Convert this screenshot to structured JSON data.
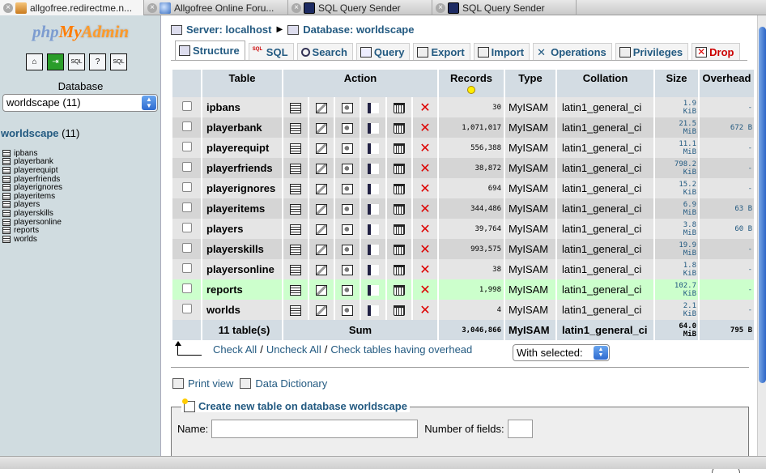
{
  "browser_tabs": [
    {
      "title": "allgofree.redirectme.n...",
      "active": true,
      "icon": "pma-favicon"
    },
    {
      "title": "Allgofree Online Foru...",
      "active": false,
      "icon": "globe-favicon"
    },
    {
      "title": "SQL Query Sender",
      "active": false,
      "icon": "sql-favicon"
    },
    {
      "title": "SQL Query Sender",
      "active": false,
      "icon": "sql-favicon"
    }
  ],
  "sidebar": {
    "logo_php": "php",
    "logo_my": "My",
    "logo_admin": "Admin",
    "db_label": "Database",
    "db_select": "worldscape (11)",
    "db_name": "worldscape",
    "db_count": " (11)",
    "tables": [
      "ipbans",
      "playerbank",
      "playerequipt",
      "playerfriends",
      "playerignores",
      "playeritems",
      "players",
      "playerskills",
      "playersonline",
      "reports",
      "worlds"
    ]
  },
  "breadcrumb": {
    "server": "Server: localhost",
    "database": "Database: worldscape"
  },
  "tabs": [
    "Structure",
    "SQL",
    "Search",
    "Query",
    "Export",
    "Import",
    "Operations",
    "Privileges",
    "Drop"
  ],
  "table": {
    "headers": {
      "table": "Table",
      "action": "Action",
      "records": "Records",
      "type": "Type",
      "collation": "Collation",
      "size": "Size",
      "overhead": "Overhead"
    },
    "rows": [
      {
        "name": "ipbans",
        "records": "30",
        "type": "MyISAM",
        "collation": "latin1_general_ci",
        "size1": "1.9",
        "size2": "KiB",
        "overhead": "-"
      },
      {
        "name": "playerbank",
        "records": "1,071,017",
        "type": "MyISAM",
        "collation": "latin1_general_ci",
        "size1": "21.5",
        "size2": "MiB",
        "overhead": "672 B"
      },
      {
        "name": "playerequipt",
        "records": "556,388",
        "type": "MyISAM",
        "collation": "latin1_general_ci",
        "size1": "11.1",
        "size2": "MiB",
        "overhead": "-"
      },
      {
        "name": "playerfriends",
        "records": "38,872",
        "type": "MyISAM",
        "collation": "latin1_general_ci",
        "size1": "798.2",
        "size2": "KiB",
        "overhead": "-"
      },
      {
        "name": "playerignores",
        "records": "694",
        "type": "MyISAM",
        "collation": "latin1_general_ci",
        "size1": "15.2",
        "size2": "KiB",
        "overhead": "-"
      },
      {
        "name": "playeritems",
        "records": "344,486",
        "type": "MyISAM",
        "collation": "latin1_general_ci",
        "size1": "6.9",
        "size2": "MiB",
        "overhead": "63 B"
      },
      {
        "name": "players",
        "records": "39,764",
        "type": "MyISAM",
        "collation": "latin1_general_ci",
        "size1": "3.8",
        "size2": "MiB",
        "overhead": "60 B"
      },
      {
        "name": "playerskills",
        "records": "993,575",
        "type": "MyISAM",
        "collation": "latin1_general_ci",
        "size1": "19.9",
        "size2": "MiB",
        "overhead": "-"
      },
      {
        "name": "playersonline",
        "records": "38",
        "type": "MyISAM",
        "collation": "latin1_general_ci",
        "size1": "1.8",
        "size2": "KiB",
        "overhead": "-"
      },
      {
        "name": "reports",
        "records": "1,998",
        "type": "MyISAM",
        "collation": "latin1_general_ci",
        "size1": "102.7",
        "size2": "KiB",
        "overhead": "-"
      },
      {
        "name": "worlds",
        "records": "4",
        "type": "MyISAM",
        "collation": "latin1_general_ci",
        "size1": "2.1",
        "size2": "KiB",
        "overhead": "-"
      }
    ],
    "footer": {
      "count": "11 table(s)",
      "sum": "Sum",
      "records": "3,046,866",
      "type": "MyISAM",
      "collation": "latin1_general_ci",
      "size1": "64.0",
      "size2": "MiB",
      "overhead": "795 B"
    }
  },
  "check": {
    "check_all": "Check All",
    "sep1": "/",
    "uncheck_all": "Uncheck All",
    "sep2": "/",
    "check_overhead": "Check tables having overhead"
  },
  "with_selected": "With selected:",
  "print_view": "Print view",
  "data_dictionary": "Data Dictionary",
  "create": {
    "legend": "Create new table on database worldscape",
    "name_label": "Name:",
    "fields_label": "Number of fields:"
  },
  "colors": {
    "link": "#235a81",
    "header_bg": "#d3dce3",
    "highlight_row": "#ccffcc"
  }
}
